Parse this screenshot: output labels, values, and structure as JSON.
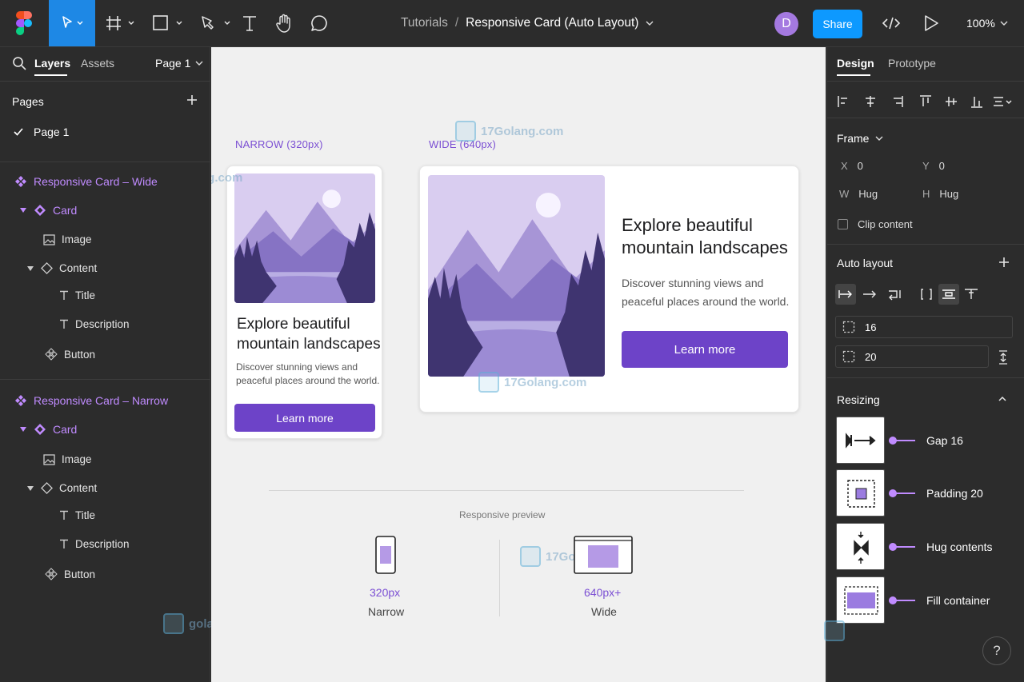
{
  "toolbar": {
    "breadcrumb_parent": "Tutorials",
    "breadcrumb_sep": "/",
    "file_title": "Responsive Card (Auto Layout)",
    "avatar_initial": "D",
    "share_label": "Share",
    "zoom": "100%",
    "accent": "#1e88e5"
  },
  "left_panel": {
    "tabs": [
      "Layers",
      "Assets"
    ],
    "page_selector": "Page 1",
    "pages_heading": "Pages",
    "current_page": "Page 1",
    "layers": [
      {
        "label": "Responsive Card – Wide",
        "icon": "component-icon"
      },
      {
        "label": "Card",
        "icon": "instance-icon"
      },
      {
        "label": "Image",
        "icon": "image-icon"
      },
      {
        "label": "Content",
        "icon": "frame-instance-icon"
      },
      {
        "label": "Title",
        "icon": "text-icon"
      },
      {
        "label": "Description",
        "icon": "text-icon"
      },
      {
        "label": "Button",
        "icon": "instance-icon"
      },
      {
        "label": "Responsive Card – Narrow",
        "icon": "component-icon"
      },
      {
        "label": "Card",
        "icon": "instance-icon"
      },
      {
        "label": "Image",
        "icon": "image-icon"
      },
      {
        "label": "Content",
        "icon": "frame-instance-icon"
      },
      {
        "label": "Title",
        "icon": "text-icon"
      },
      {
        "label": "Description",
        "icon": "text-icon"
      },
      {
        "label": "Button",
        "icon": "instance-icon"
      }
    ]
  },
  "canvas": {
    "narrow_label": "NARROW (320px)",
    "wide_label": "WIDE (640px)",
    "card": {
      "title": "Explore beautiful mountain landscapes",
      "title_line1": "Explore beautiful",
      "title_line2": "mountain landscapes",
      "desc_line1": "Discover stunning views and",
      "desc_line2": "peaceful places around the world.",
      "button": "Learn more",
      "button_color": "#6d43c8"
    },
    "watermark": "17Golang.com",
    "watermark_partial": "golang.com",
    "preview_heading": "Responsive preview",
    "preview": [
      {
        "value": "320px",
        "label": "Narrow"
      },
      {
        "value": "640px+",
        "label": "Wide"
      }
    ]
  },
  "right_panel": {
    "tabs": [
      "Design",
      "Prototype"
    ],
    "frame_heading": "Frame",
    "x_key": "X",
    "x_val": "0",
    "y_key": "Y",
    "y_val": "0",
    "w_key": "W",
    "w_val": "Hug",
    "h_key": "H",
    "h_val": "Hug",
    "clip_content": "Clip content",
    "auto_layout_heading": "Auto layout",
    "gap_value": "16",
    "padding_value": "20",
    "resizing_heading": "Resizing",
    "resizing": [
      {
        "label": "Gap 16"
      },
      {
        "label": "Padding 20"
      },
      {
        "label": "Hug contents"
      },
      {
        "label": "Fill container"
      }
    ],
    "help": "?"
  }
}
